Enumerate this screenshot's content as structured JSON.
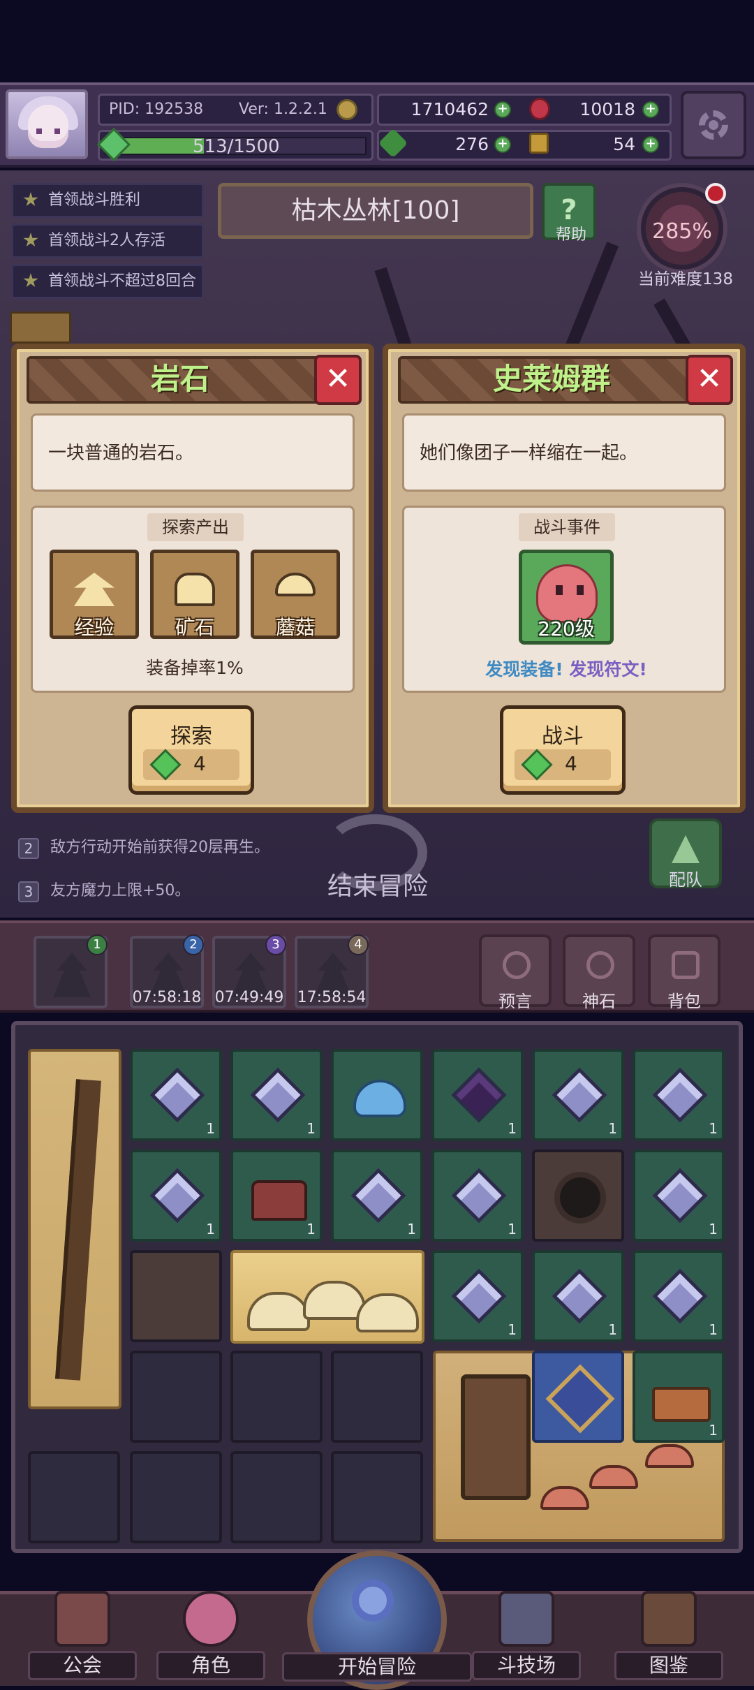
{
  "header": {
    "pid": "PID: 192538",
    "version": "Ver: 1.2.2.1",
    "xp": "513/1500",
    "gold": "1710462",
    "gems": "10018",
    "clover": "276",
    "keys": "54"
  },
  "objectives": [
    "首领战斗胜利",
    "首领战斗2人存活",
    "首领战斗不超过8回合"
  ],
  "stage": {
    "name": "枯木丛林[100]",
    "help_label": "帮助",
    "help_icon": "?",
    "difficulty_pct": "285%",
    "difficulty_label": "当前难度138"
  },
  "panel_left": {
    "title": "岩石",
    "close": "✕",
    "description": "一块普通的岩石。",
    "section_label": "探索产出",
    "rewards": [
      "经验",
      "矿石",
      "蘑菇"
    ],
    "drop_rate": "装备掉率1%",
    "button_label": "探索",
    "cost": "4"
  },
  "panel_right": {
    "title": "史莱姆群",
    "close": "✕",
    "description": "她们像团子一样缩在一起。",
    "section_label": "战斗事件",
    "enemy_level": "220级",
    "found_equipment": "发现装备!",
    "found_rune": "发现符文!",
    "button_label": "战斗",
    "cost": "4"
  },
  "rules": [
    {
      "num": "2",
      "text": "敌方行动开始前获得20层再生。"
    },
    {
      "num": "3",
      "text": "友方魔力上限+50。"
    }
  ],
  "end_adventure": "结束冒险",
  "team_label": "配队",
  "party": {
    "slots": [
      "1",
      "2",
      "3",
      "4"
    ],
    "timers": [
      "07:58:18",
      "07:49:49",
      "17:58:54"
    ]
  },
  "side_buttons": {
    "prophecy": "预言",
    "godstone": "神石",
    "bag": "背包"
  },
  "inventory_count": "1",
  "nav": {
    "guild": "公会",
    "character": "角色",
    "start": "开始冒险",
    "arena": "斗技场",
    "codex": "图鉴"
  }
}
